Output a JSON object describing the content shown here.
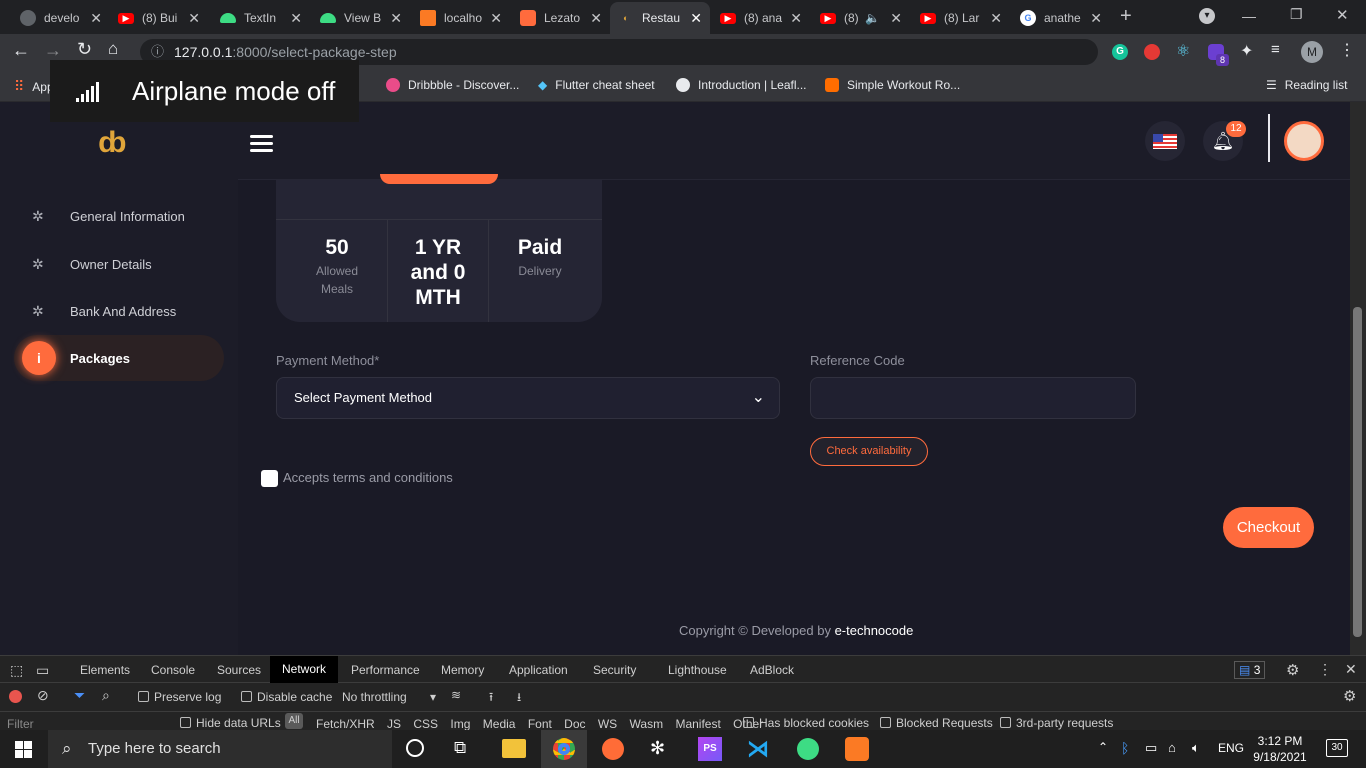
{
  "tabs": [
    {
      "label": "develo",
      "icon": "chrome-icon"
    },
    {
      "label": "(8) Bui",
      "icon": "youtube-icon"
    },
    {
      "label": "TextIn",
      "icon": "android-icon"
    },
    {
      "label": "View B",
      "icon": "android-icon"
    },
    {
      "label": "localho",
      "icon": "xampp-icon"
    },
    {
      "label": "Lezato",
      "icon": "lezato-icon"
    },
    {
      "label": "Restau",
      "icon": "restaurant-icon"
    },
    {
      "label": "(8) ana",
      "icon": "youtube-icon"
    },
    {
      "label": "(8)",
      "icon": "youtube-icon"
    },
    {
      "label": "(8) Lar",
      "icon": "youtube-icon"
    },
    {
      "label": "anathe",
      "icon": "google-icon"
    }
  ],
  "address": {
    "host": "127.0.0.1",
    "path": ":8000/select-package-step"
  },
  "profile_initial": "M",
  "extension_badge": "8",
  "bookmarks": [
    {
      "label": "Apps"
    },
    {
      "label": "Dribbble - Discover..."
    },
    {
      "label": "Flutter cheat sheet"
    },
    {
      "label": "Introduction | Leafl..."
    },
    {
      "label": "Simple Workout Ro..."
    }
  ],
  "reading_list": "Reading list",
  "toast": "Airplane mode off",
  "sidebar": {
    "items": [
      {
        "label": "General Information"
      },
      {
        "label": "Owner Details"
      },
      {
        "label": "Bank And Address"
      },
      {
        "label": "Packages"
      }
    ]
  },
  "header": {
    "notification_count": "12"
  },
  "package": {
    "stats": [
      {
        "value": "50",
        "label": "Allowed Meals"
      },
      {
        "value": "1 YR and 0 MTH",
        "label": ""
      },
      {
        "value": "Paid",
        "label": "Delivery"
      }
    ]
  },
  "form": {
    "payment_label": "Payment Method*",
    "payment_value": "Select Payment Method",
    "reference_label": "Reference Code",
    "reference_value": "",
    "check_button": "Check availability",
    "terms_label": "Accepts terms and conditions",
    "checkout_button": "Checkout"
  },
  "footer": {
    "text": "Copyright © Developed by",
    "brand": "e-technocode"
  },
  "devtools": {
    "tabs": [
      "Elements",
      "Console",
      "Sources",
      "Network",
      "Performance",
      "Memory",
      "Application",
      "Security",
      "Lighthouse",
      "AdBlock"
    ],
    "active_tab": "Network",
    "issues_count": "3",
    "preserve_log": "Preserve log",
    "disable_cache": "Disable cache",
    "throttling": "No throttling",
    "filter_placeholder": "Filter",
    "hide_data_urls": "Hide data URLs",
    "filter_types": [
      "Fetch/XHR",
      "JS",
      "CSS",
      "Img",
      "Media",
      "Font",
      "Doc",
      "WS",
      "Wasm",
      "Manifest",
      "Other"
    ],
    "has_blocked_cookies": "Has blocked cookies",
    "blocked_requests": "Blocked Requests",
    "third_party": "3rd-party requests"
  },
  "taskbar": {
    "search_placeholder": "Type here to search",
    "language": "ENG",
    "time": "3:12 PM",
    "date": "9/18/2021",
    "notifications": "30"
  },
  "colors": {
    "accent": "#ff6b3d",
    "background": "#1a1a26",
    "sidebar": "#1c1c28"
  }
}
